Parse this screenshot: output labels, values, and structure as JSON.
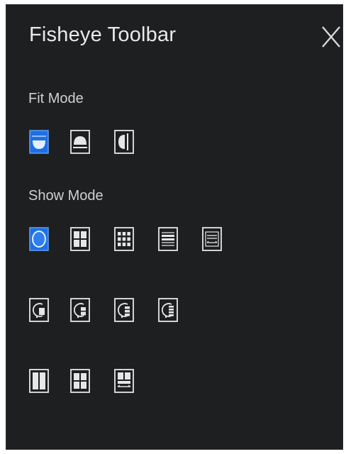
{
  "toolbar": {
    "title": "Fisheye Toolbar",
    "close_icon": "close-icon"
  },
  "fit_mode": {
    "label": "Fit Mode",
    "selected": "ceiling",
    "options": [
      "ceiling-mount-icon",
      "desktop-mount-icon",
      "wall-mount-icon"
    ]
  },
  "show_mode": {
    "label": "Show Mode",
    "selected": "original",
    "row1": [
      "fisheye-original-icon",
      "quad-view-icon",
      "grid-view-icon",
      "panorama-icon",
      "panorama-360-icon"
    ],
    "row2": [
      "fisheye-single-view-icon",
      "fisheye-double-view-icon",
      "fisheye-triple-view-icon",
      "fisheye-quad-view-icon"
    ],
    "row3": [
      "dual-panel-icon",
      "four-panel-icon",
      "panel-with-strip-icon"
    ]
  },
  "colors": {
    "background": "#1e1f21",
    "icon": "#e6e6e6",
    "selected": "#1d6fe6"
  }
}
